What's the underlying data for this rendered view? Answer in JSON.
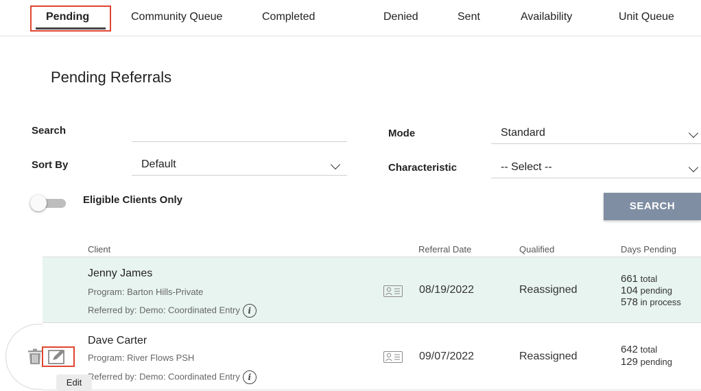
{
  "tabs": [
    {
      "label": "Pending",
      "active": true
    },
    {
      "label": "Community Queue",
      "active": false
    },
    {
      "label": "Completed",
      "active": false
    },
    {
      "label": "Denied",
      "active": false
    },
    {
      "label": "Sent",
      "active": false
    },
    {
      "label": "Availability",
      "active": false
    },
    {
      "label": "Unit Queue",
      "active": false
    }
  ],
  "page_title": "Pending Referrals",
  "filters": {
    "search_label": "Search",
    "search_value": "",
    "mode_label": "Mode",
    "mode_value": "Standard",
    "sort_label": "Sort By",
    "sort_value": "Default",
    "characteristic_label": "Characteristic",
    "characteristic_value": "-- Select --",
    "eligible_label": "Eligible Clients Only",
    "eligible_on": false,
    "search_button": "SEARCH"
  },
  "table": {
    "columns": [
      "Client",
      "Referral Date",
      "Qualified",
      "Days Pending"
    ],
    "rows": [
      {
        "name": "Jenny James",
        "program": "Program: Barton Hills-Private",
        "referred_by": "Referred by: Demo: Coordinated Entry",
        "date": "08/19/2022",
        "qualified": "Reassigned",
        "total_num": "661",
        "total_lbl": "total",
        "pending_num": "104",
        "pending_lbl": "pending",
        "process_num": "578",
        "process_lbl": "in process",
        "highlighted": true
      },
      {
        "name": "Dave Carter",
        "program": "Program: River Flows PSH",
        "referred_by": "Referred by: Demo: Coordinated Entry",
        "date": "09/07/2022",
        "qualified": "Reassigned",
        "total_num": "642",
        "total_lbl": "total",
        "pending_num": "129",
        "pending_lbl": "pending",
        "highlighted": false
      }
    ]
  },
  "tooltip": "Edit",
  "colors": {
    "accent_red": "#e0442f",
    "row_highlight": "#e8f4ef",
    "button": "#7f8ea3"
  },
  "icons": [
    "trash-icon",
    "edit-icon",
    "contact-card-icon",
    "info-icon",
    "chevron-down-icon"
  ]
}
